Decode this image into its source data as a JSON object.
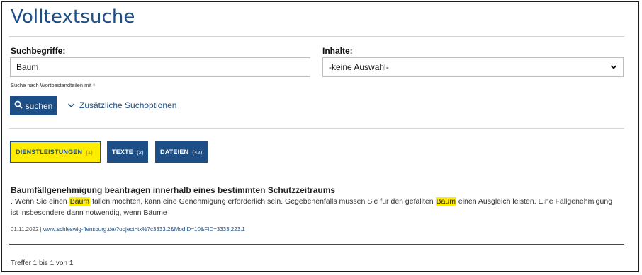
{
  "page": {
    "title": "Volltextsuche"
  },
  "form": {
    "search_label": "Suchbegriffe:",
    "search_value": "Baum",
    "content_label": "Inhalte:",
    "content_selected": "-keine Auswahl-",
    "hint": "Suche nach Wortbestandteilen mit *",
    "search_button": "suchen",
    "more_options": "Zusätzliche Suchoptionen"
  },
  "tabs": [
    {
      "label": "DIENSTLEISTUNGEN",
      "count": "(1)",
      "active": true
    },
    {
      "label": "TEXTE",
      "count": "(2)",
      "active": false
    },
    {
      "label": "DATEIEN",
      "count": "(42)",
      "active": false
    }
  ],
  "result": {
    "title": "Baumfällgenehmigung beantragen innerhalb eines bestimmten Schutzzeitraums",
    "snippet_1": ". Wenn Sie einen ",
    "highlight_1": "Baum",
    "snippet_2": " fällen möchten, kann eine Genehmigung erforderlich sein. Gegebenenfalls müssen Sie für den gefällten ",
    "highlight_2": "Baum",
    "snippet_3": " einen Ausgleich leisten. Eine Fällgenehmigung ist insbesondere dann notwendig, wenn Bäume",
    "date": "01.11.2022",
    "separator": " | ",
    "url": "www.schleswig-flensburg.de/?object=tx%7c3333.2&ModID=10&FID=3333.223.1"
  },
  "footer": {
    "hits": "Treffer 1 bis 1 von 1"
  },
  "colors": {
    "accent": "#1d4f86",
    "highlight": "#ffed00"
  }
}
